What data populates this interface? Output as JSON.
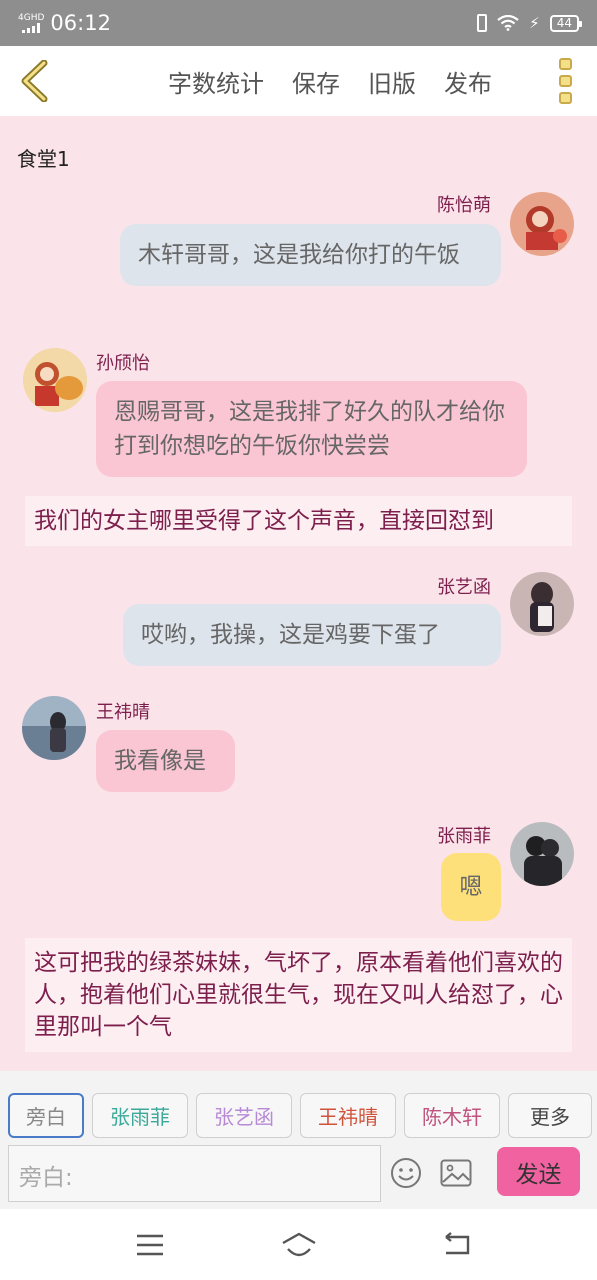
{
  "status_bar": {
    "network": "4GHD",
    "time": "06:12",
    "battery": "44"
  },
  "nav": {
    "actions": [
      "字数统计",
      "保存",
      "旧版",
      "发布"
    ]
  },
  "scene": {
    "title": "食堂1"
  },
  "messages": [
    {
      "speaker": "陈怡萌",
      "text": "木轩哥哥，这是我给你打的午饭",
      "side": "right",
      "bubble_color": "#dee4ec"
    },
    {
      "speaker": "孙颀怡",
      "text": "恩赐哥哥，这是我排了好久的队才给你打到你想吃的午饭你快尝尝",
      "side": "left",
      "bubble_color": "#fbc6d4"
    },
    {
      "narration": "我们的女主哪里受得了这个声音，直接回怼到"
    },
    {
      "speaker": "张艺函",
      "text": "哎哟，我操，这是鸡要下蛋了",
      "side": "right",
      "bubble_color": "#dee4ec"
    },
    {
      "speaker": "王祎晴",
      "text": "我看像是",
      "side": "left",
      "bubble_color": "#fbc6d4"
    },
    {
      "speaker": "张雨菲",
      "text": "嗯",
      "side": "right",
      "bubble_color": "#fde07a"
    },
    {
      "narration": "这可把我的绿茶妹妹，气坏了，原本看着他们喜欢的人，抱着他们心里就很生气，现在又叫人给怼了，心里那叫一个气"
    }
  ],
  "composer": {
    "roles": [
      {
        "label": "旁白",
        "color": "#888888"
      },
      {
        "label": "张雨菲",
        "color": "#3aa89a"
      },
      {
        "label": "张艺函",
        "color": "#b78ad6"
      },
      {
        "label": "王祎晴",
        "color": "#d0523a"
      },
      {
        "label": "陈木轩",
        "color": "#c0527e"
      },
      {
        "label": "更多",
        "color": "#444444"
      }
    ],
    "input_placeholder": "旁白:",
    "send_label": "发送"
  },
  "colors": {
    "background": "#fbe3ea",
    "name_text": "#7d1f4c",
    "send_button": "#f062a0",
    "status_bar": "#8e8e8e"
  }
}
